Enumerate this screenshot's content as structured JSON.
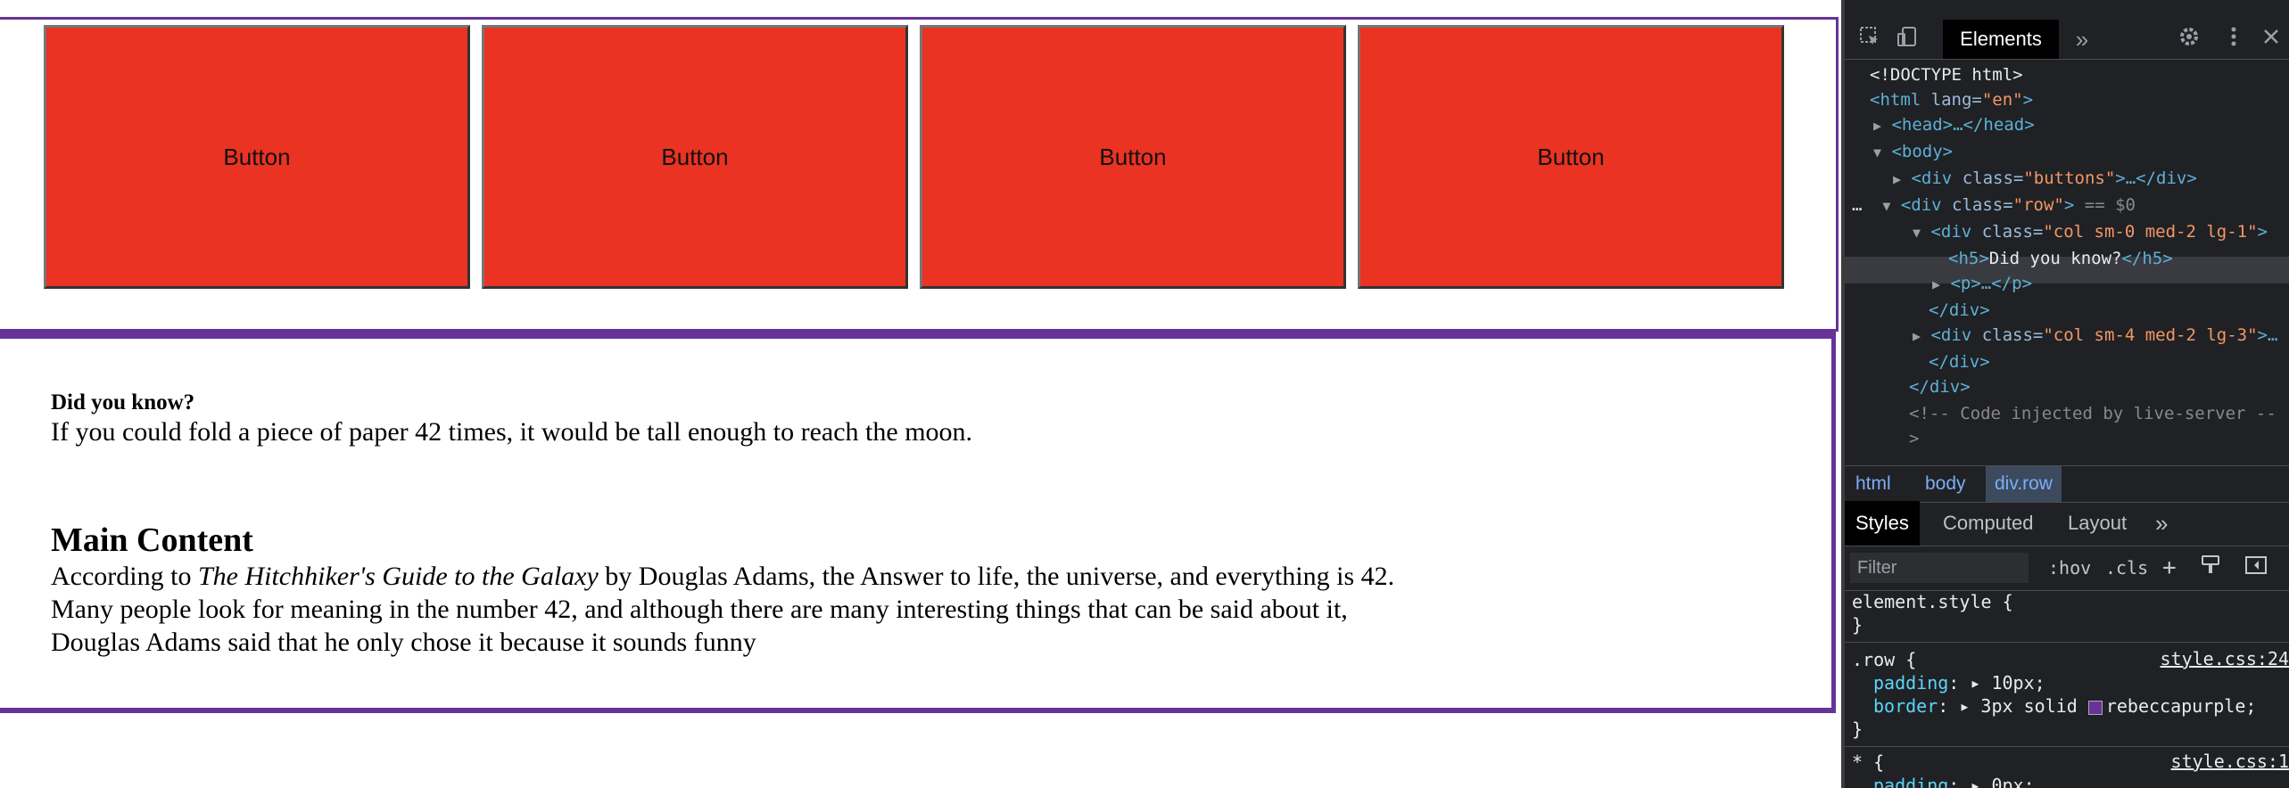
{
  "page": {
    "buttons": [
      "Button",
      "Button",
      "Button",
      "Button"
    ],
    "did_you_know_title": "Did you know?",
    "did_you_know_text": "If you could fold a piece of paper 42 times, it would be tall enough to reach the moon.",
    "main_title": "Main Content",
    "main_text_before": "According to ",
    "main_text_italic": "The Hitchhiker's Guide to the Galaxy",
    "main_text_after": " by Douglas Adams, the Answer to life, the universe, and everything is 42. Many people look for meaning in the number 42, and although there are many interesting things that can be said about it, Douglas Adams said that he only chose it because it sounds funny"
  },
  "devtools": {
    "active_tab": "Elements",
    "more_tabs": "»",
    "tree": {
      "doctype": "<!DOCTYPE html>",
      "html_tag": "<html",
      "html_attr": " lang=",
      "html_val": "\"en\"",
      "head": "<head>…</head>",
      "body": "<body>",
      "div_buttons_open": "<div",
      "div_buttons_attr": " class=",
      "div_buttons_val": "\"buttons\"",
      "div_buttons_close": ">…</div>",
      "row_dots": "…",
      "row_open": "<div",
      "row_attr": " class=",
      "row_val": "\"row\"",
      "row_end": ">",
      "row_eq": " == $0",
      "col1_open": "<div",
      "col1_attr": " class=",
      "col1_val": "\"col sm-0 med-2 lg-1\"",
      "col1_end": ">",
      "h5_open": "<h5>",
      "h5_text": "Did you know?",
      "h5_close": "</h5>",
      "p": "<p>…</p>",
      "div_close1": "</div>",
      "col2_open": "<div",
      "col2_attr": " class=",
      "col2_val": "\"col sm-4 med-2 lg-3\"",
      "col2_end": ">…",
      "div_close2": "</div>",
      "div_close3": "</div>",
      "comment": "<!-- Code injected by live-server --",
      "comment_end": ">"
    },
    "breadcrumb": [
      "html",
      "body",
      "div.row"
    ],
    "styles_tabs": [
      "Styles",
      "Computed",
      "Layout",
      "»"
    ],
    "filter_placeholder": "Filter",
    "filter_buttons": [
      ":hov",
      ".cls",
      "+"
    ],
    "rules": {
      "element_style": "element.style {",
      "close_brace": "}",
      "row_selector": ".row {",
      "row_link": "style.css:24",
      "padding_prop": "padding",
      "padding_val": ": ▸ 10px;",
      "border_prop": "border",
      "border_val_pre": ": ▸ 3px solid ",
      "border_val_color": "rebeccapurple;",
      "star_selector": "* {",
      "star_link": "style.css:1",
      "star_prop": "padding",
      "star_val": ": ▸ 0px;"
    }
  }
}
